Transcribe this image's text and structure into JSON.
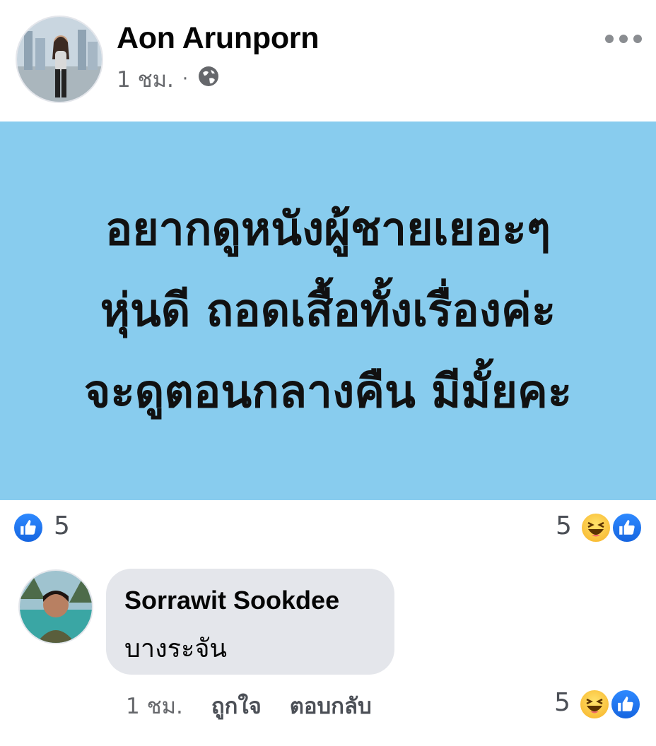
{
  "post": {
    "author_name": "Aon Arunporn",
    "time": "1 ชม.",
    "separator": "·",
    "privacy_icon": "globe-icon",
    "more_icon": "more-options-icon",
    "status_lines": [
      "อยากดูหนังผู้ชายเยอะๆ",
      "หุ่นดี ถอดเสื้อทั้งเรื่องค่ะ",
      "จะดูตอนกลางคืน มีมั้ยคะ"
    ],
    "background_color": "#88ccee"
  },
  "reactions": {
    "left_count": "5",
    "right_count": "5",
    "icons": [
      "like-icon",
      "haha-icon"
    ]
  },
  "comment": {
    "author_name": "Sorrawit Sookdee",
    "text": "บางระจัน",
    "time": "1 ชม.",
    "like_label": "ถูกใจ",
    "reply_label": "ตอบกลับ",
    "reaction_count": "5"
  }
}
